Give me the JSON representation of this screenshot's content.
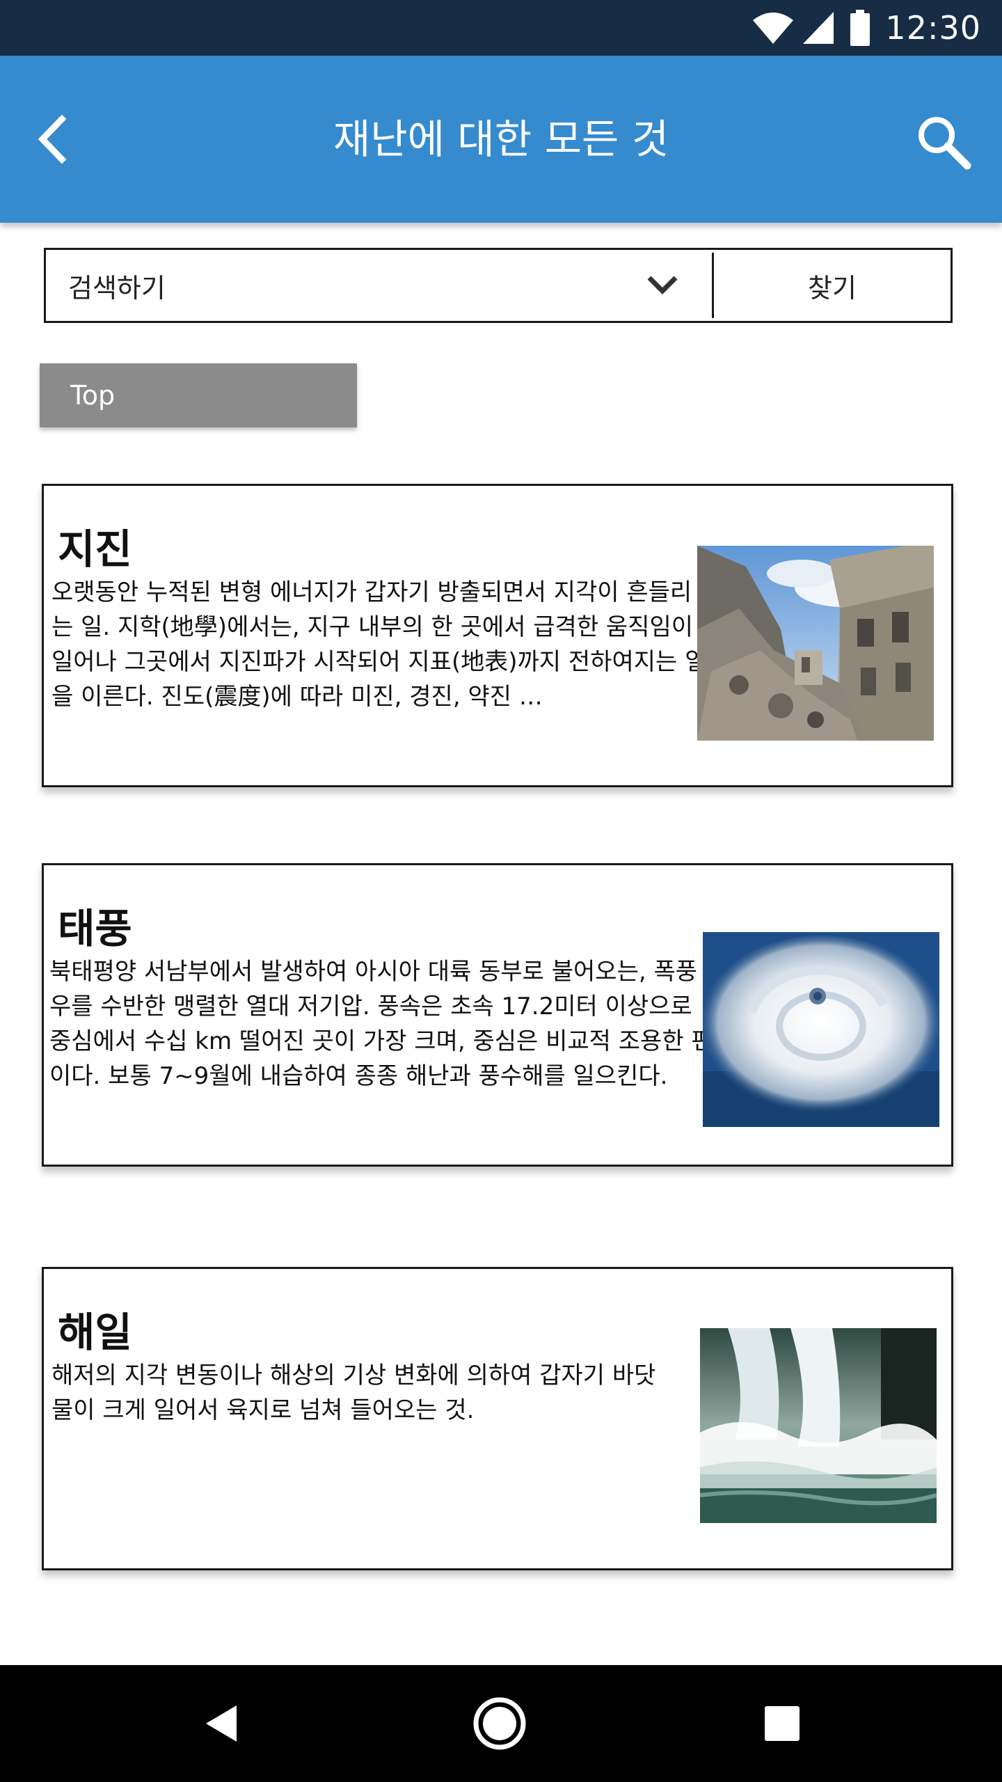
{
  "status_bar": {
    "time": "12:30",
    "icons": [
      "wifi-icon",
      "signal-icon",
      "battery-icon"
    ]
  },
  "app_bar": {
    "title": "재난에 대한 모든 것",
    "back_icon": "back-arrow-icon",
    "search_icon": "search-icon"
  },
  "search": {
    "dropdown_value": "검색하기",
    "find_label": "찾기"
  },
  "top_button": {
    "label": "Top"
  },
  "cards": [
    {
      "title": "지진",
      "description": "오랫동안 누적된 변형 에너지가 갑자기 방출되면서 지각이 흔들리는 일. 지학(地學)에서는, 지구 내부의 한 곳에서 급격한 움직임이 일어나 그곳에서 지진파가 시작되어 지표(地表)까지 전하여지는 일을 이른다. 진도(震度)에 따라 미진, 경진, 약진 …",
      "image": "earthquake-ruins-photo"
    },
    {
      "title": "태풍",
      "description": "북태평양 서남부에서 발생하여 아시아 대륙 동부로 불어오는, 폭풍우를 수반한 맹렬한 열대 저기압. 풍속은 초속 17.2미터 이상으로 중심에서 수십 km 떨어진 곳이 가장 크며, 중심은 비교적 조용한 편이다. 보통 7~9월에 내습하여 종종 해난과 풍수해를 일으킨다.",
      "image": "typhoon-satellite-photo"
    },
    {
      "title": "해일",
      "description": "해저의 지각 변동이나 해상의 기상 변화에 의하여 갑자기 바닷물이 크게 일어서 육지로 넘쳐 들어오는 것.",
      "image": "sea-wave-splash-photo"
    }
  ],
  "colors": {
    "status_bar": "#172c45",
    "app_bar": "#358bce",
    "top_button": "#8b8b8b",
    "nav_bar": "#000000"
  },
  "nav_bar": {
    "back_icon": "nav-back-icon",
    "home_icon": "nav-home-icon",
    "recents_icon": "nav-recents-icon"
  }
}
